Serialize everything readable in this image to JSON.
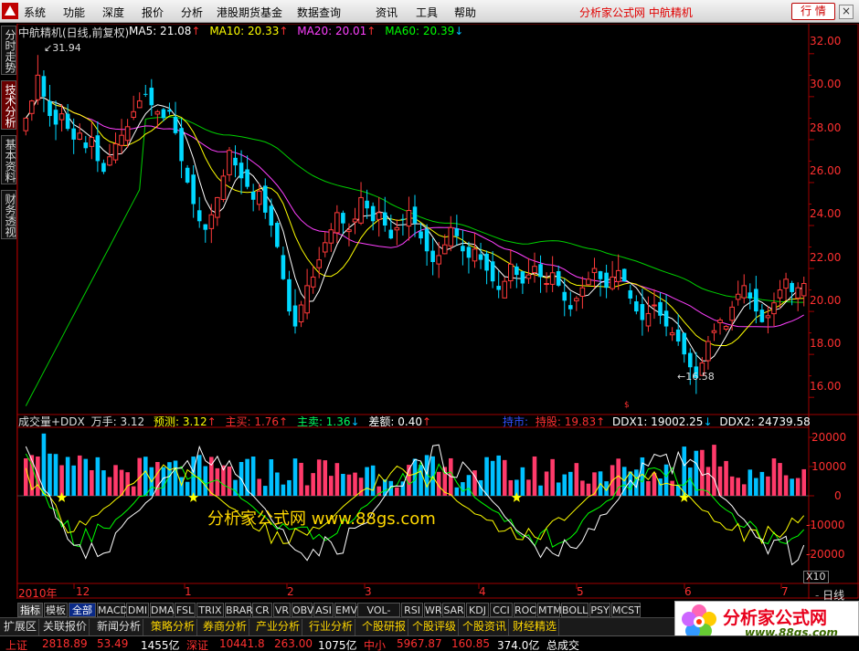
{
  "menu": {
    "items": [
      "系统",
      "功能",
      "深度",
      "报价",
      "分析",
      "港股期货基金",
      "数据查询",
      "资讯",
      "工具",
      "帮助"
    ],
    "brand": "分析家公式网 中航精机",
    "quote_button": "行 情"
  },
  "side_tabs": [
    "分时走势",
    "技术分析",
    "基本资料",
    "财务透视"
  ],
  "price_panel": {
    "header_name": "中航精机(日线,前复权)",
    "ma": [
      {
        "label": "MA5: 21.08",
        "arrow": "↑",
        "color": "#ffffff"
      },
      {
        "label": "MA10: 20.33",
        "arrow": "↑",
        "color": "#ffff00"
      },
      {
        "label": "MA20: 20.01",
        "arrow": "↑",
        "color": "#ff40ff"
      },
      {
        "label": "MA60: 20.39",
        "arrow": "↓",
        "color": "#00ff00"
      }
    ],
    "y_ticks": [
      "32.00",
      "30.00",
      "28.00",
      "26.00",
      "24.00",
      "22.00",
      "20.00",
      "18.00",
      "16.00"
    ],
    "high_label": "31.94",
    "low_label": "16.58"
  },
  "volume_panel": {
    "title": "成交量+DDX",
    "unit": "万手: 3.12",
    "items": [
      {
        "label": "预测: 3.12",
        "arrow": "↑",
        "color": "#ffff00"
      },
      {
        "label": "主买: 1.76",
        "arrow": "↑",
        "color": "#ff3030"
      },
      {
        "label": "主卖: 1.36",
        "arrow": "↓",
        "color": "#00ff60"
      },
      {
        "label": "差额: 0.40",
        "arrow": "↑",
        "color": "#ffffff"
      }
    ],
    "right_items": [
      {
        "label": "持市:",
        "color": "#3050ff"
      },
      {
        "label": "持股: 19.83",
        "arrow": "↑",
        "color": "#ff3030"
      },
      {
        "label": "DDX1: 19002.25",
        "arrow": "↓",
        "color": "#ffffff"
      },
      {
        "label": "DDX2: 24739.58",
        "arrow": "",
        "color": "#ffffff"
      }
    ],
    "y_ticks": [
      "20000",
      "10000",
      "0",
      "-10000",
      "-20000"
    ],
    "watermark": "分析家公式网 www.88gs.com"
  },
  "x_axis": {
    "labels": [
      "2010年",
      "12",
      "1",
      "2",
      "3",
      "4",
      "5",
      "6",
      "7"
    ],
    "zoom": "X10",
    "period": "日线"
  },
  "indicator_tabs": [
    "指标",
    "模板",
    "全部",
    "MACD",
    "DMI",
    "DMA",
    "FSL",
    "TRIX",
    "BRAR",
    "CR",
    "VR",
    "OBV",
    "ASI",
    "EMV",
    "VOL-TDX",
    "RSI",
    "WR",
    "SAR",
    "KDJ",
    "CCI",
    "ROC",
    "MTM",
    "BOLL",
    "PSY",
    "MCST"
  ],
  "toolbar": [
    "扩展区",
    "关联报价",
    "新闻分析",
    "策略分析",
    "券商分析",
    "产业分析",
    "行业分析",
    "个股研报",
    "个股评级",
    "个股资讯",
    "财经精选"
  ],
  "brand_box": {
    "title": "分析家公式网",
    "url": "www.88gs.com"
  },
  "status": [
    {
      "text": "上证",
      "color": "#ff3030"
    },
    {
      "text": "2818.89",
      "color": "#ff3030"
    },
    {
      "text": "53.49",
      "color": "#ff3030"
    },
    {
      "text": "1455亿",
      "color": "#ffffff"
    },
    {
      "text": "深证",
      "color": "#ff3030"
    },
    {
      "text": "10441.8",
      "color": "#ff3030"
    },
    {
      "text": "263.00",
      "color": "#ff3030"
    },
    {
      "text": "1075亿",
      "color": "#ffffff"
    },
    {
      "text": "中小",
      "color": "#ff3030"
    },
    {
      "text": "5967.87",
      "color": "#ff3030"
    },
    {
      "text": "160.85",
      "color": "#ff3030"
    },
    {
      "text": "374.0亿",
      "color": "#ffffff"
    },
    {
      "text": "总成交",
      "color": "#ffffff"
    }
  ],
  "chart_data": {
    "type": "candlestick",
    "ylim": [
      15.2,
      32.8
    ],
    "high": 31.94,
    "low": 16.58,
    "closes": [
      29.0,
      29.8,
      31.0,
      30.0,
      29.1,
      28.7,
      29.2,
      28.5,
      28.0,
      28.3,
      27.6,
      28.1,
      27.0,
      26.5,
      27.2,
      27.8,
      28.2,
      28.6,
      29.3,
      29.8,
      30.1,
      29.6,
      29.3,
      29.0,
      29.3,
      28.3,
      27.0,
      26.0,
      25.0,
      24.2,
      23.8,
      24.5,
      25.3,
      26.3,
      27.5,
      26.8,
      26.2,
      25.8,
      25.2,
      25.6,
      24.6,
      24.0,
      23.0,
      21.5,
      20.0,
      19.3,
      20.3,
      21.2,
      21.6,
      22.4,
      23.2,
      23.8,
      24.6,
      24.1,
      23.8,
      24.3,
      25.3,
      24.8,
      24.2,
      24.6,
      24.0,
      23.4,
      23.9,
      24.3,
      24.7,
      24.1,
      23.4,
      22.8,
      22.3,
      22.6,
      23.1,
      23.9,
      23.5,
      22.8,
      22.5,
      22.9,
      22.4,
      21.9,
      21.4,
      21.0,
      21.4,
      22.2,
      21.7,
      21.3,
      21.7,
      22.1,
      21.6,
      21.3,
      21.8,
      21.2,
      20.5,
      20.1,
      20.6,
      21.1,
      21.5,
      22.0,
      21.5,
      21.1,
      21.6,
      21.9,
      21.4,
      20.6,
      20.0,
      19.6,
      19.9,
      20.3,
      19.8,
      19.3,
      19.0,
      18.6,
      18.0,
      17.4,
      16.9,
      17.6,
      18.6,
      19.1,
      19.6,
      19.3,
      20.2,
      20.8,
      21.2,
      20.6,
      20.0,
      19.5,
      19.8,
      20.4,
      21.0,
      21.5,
      20.9,
      21.1,
      21.3
    ],
    "ma5_last": 21.08,
    "ma10_last": 20.33,
    "ma20_last": 20.01,
    "ma60_last": 20.39
  }
}
